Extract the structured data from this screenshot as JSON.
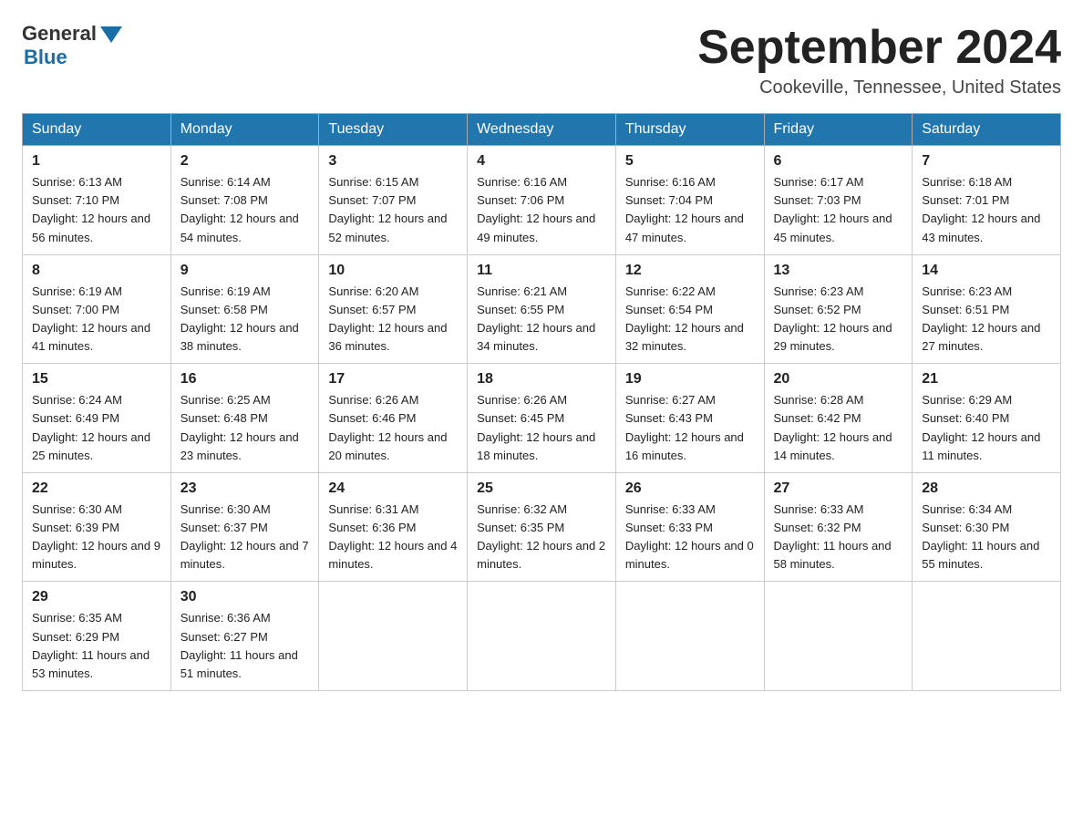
{
  "header": {
    "logo_general": "General",
    "logo_blue": "Blue",
    "title": "September 2024",
    "subtitle": "Cookeville, Tennessee, United States"
  },
  "weekdays": [
    "Sunday",
    "Monday",
    "Tuesday",
    "Wednesday",
    "Thursday",
    "Friday",
    "Saturday"
  ],
  "weeks": [
    [
      {
        "day": "1",
        "sunrise": "6:13 AM",
        "sunset": "7:10 PM",
        "daylight": "12 hours and 56 minutes."
      },
      {
        "day": "2",
        "sunrise": "6:14 AM",
        "sunset": "7:08 PM",
        "daylight": "12 hours and 54 minutes."
      },
      {
        "day": "3",
        "sunrise": "6:15 AM",
        "sunset": "7:07 PM",
        "daylight": "12 hours and 52 minutes."
      },
      {
        "day": "4",
        "sunrise": "6:16 AM",
        "sunset": "7:06 PM",
        "daylight": "12 hours and 49 minutes."
      },
      {
        "day": "5",
        "sunrise": "6:16 AM",
        "sunset": "7:04 PM",
        "daylight": "12 hours and 47 minutes."
      },
      {
        "day": "6",
        "sunrise": "6:17 AM",
        "sunset": "7:03 PM",
        "daylight": "12 hours and 45 minutes."
      },
      {
        "day": "7",
        "sunrise": "6:18 AM",
        "sunset": "7:01 PM",
        "daylight": "12 hours and 43 minutes."
      }
    ],
    [
      {
        "day": "8",
        "sunrise": "6:19 AM",
        "sunset": "7:00 PM",
        "daylight": "12 hours and 41 minutes."
      },
      {
        "day": "9",
        "sunrise": "6:19 AM",
        "sunset": "6:58 PM",
        "daylight": "12 hours and 38 minutes."
      },
      {
        "day": "10",
        "sunrise": "6:20 AM",
        "sunset": "6:57 PM",
        "daylight": "12 hours and 36 minutes."
      },
      {
        "day": "11",
        "sunrise": "6:21 AM",
        "sunset": "6:55 PM",
        "daylight": "12 hours and 34 minutes."
      },
      {
        "day": "12",
        "sunrise": "6:22 AM",
        "sunset": "6:54 PM",
        "daylight": "12 hours and 32 minutes."
      },
      {
        "day": "13",
        "sunrise": "6:23 AM",
        "sunset": "6:52 PM",
        "daylight": "12 hours and 29 minutes."
      },
      {
        "day": "14",
        "sunrise": "6:23 AM",
        "sunset": "6:51 PM",
        "daylight": "12 hours and 27 minutes."
      }
    ],
    [
      {
        "day": "15",
        "sunrise": "6:24 AM",
        "sunset": "6:49 PM",
        "daylight": "12 hours and 25 minutes."
      },
      {
        "day": "16",
        "sunrise": "6:25 AM",
        "sunset": "6:48 PM",
        "daylight": "12 hours and 23 minutes."
      },
      {
        "day": "17",
        "sunrise": "6:26 AM",
        "sunset": "6:46 PM",
        "daylight": "12 hours and 20 minutes."
      },
      {
        "day": "18",
        "sunrise": "6:26 AM",
        "sunset": "6:45 PM",
        "daylight": "12 hours and 18 minutes."
      },
      {
        "day": "19",
        "sunrise": "6:27 AM",
        "sunset": "6:43 PM",
        "daylight": "12 hours and 16 minutes."
      },
      {
        "day": "20",
        "sunrise": "6:28 AM",
        "sunset": "6:42 PM",
        "daylight": "12 hours and 14 minutes."
      },
      {
        "day": "21",
        "sunrise": "6:29 AM",
        "sunset": "6:40 PM",
        "daylight": "12 hours and 11 minutes."
      }
    ],
    [
      {
        "day": "22",
        "sunrise": "6:30 AM",
        "sunset": "6:39 PM",
        "daylight": "12 hours and 9 minutes."
      },
      {
        "day": "23",
        "sunrise": "6:30 AM",
        "sunset": "6:37 PM",
        "daylight": "12 hours and 7 minutes."
      },
      {
        "day": "24",
        "sunrise": "6:31 AM",
        "sunset": "6:36 PM",
        "daylight": "12 hours and 4 minutes."
      },
      {
        "day": "25",
        "sunrise": "6:32 AM",
        "sunset": "6:35 PM",
        "daylight": "12 hours and 2 minutes."
      },
      {
        "day": "26",
        "sunrise": "6:33 AM",
        "sunset": "6:33 PM",
        "daylight": "12 hours and 0 minutes."
      },
      {
        "day": "27",
        "sunrise": "6:33 AM",
        "sunset": "6:32 PM",
        "daylight": "11 hours and 58 minutes."
      },
      {
        "day": "28",
        "sunrise": "6:34 AM",
        "sunset": "6:30 PM",
        "daylight": "11 hours and 55 minutes."
      }
    ],
    [
      {
        "day": "29",
        "sunrise": "6:35 AM",
        "sunset": "6:29 PM",
        "daylight": "11 hours and 53 minutes."
      },
      {
        "day": "30",
        "sunrise": "6:36 AM",
        "sunset": "6:27 PM",
        "daylight": "11 hours and 51 minutes."
      },
      null,
      null,
      null,
      null,
      null
    ]
  ]
}
